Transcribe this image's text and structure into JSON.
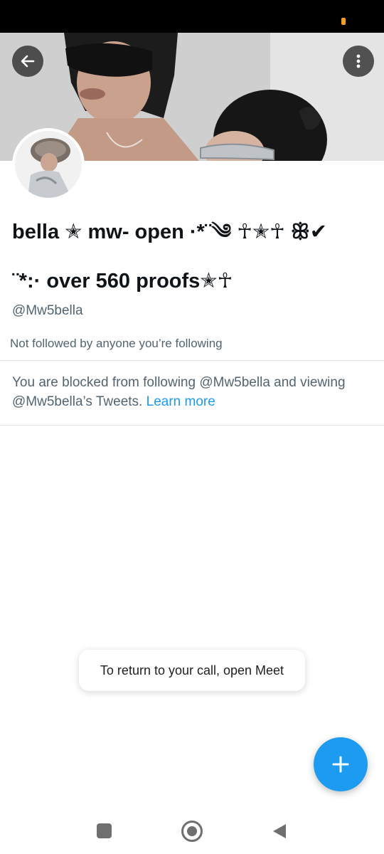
{
  "colors": {
    "accent": "#1d9bf0",
    "text_primary": "#0f1419",
    "text_secondary": "#536471",
    "status_indicator": "#f0a02b"
  },
  "header": {
    "back_icon": "arrow-left-icon",
    "more_icon": "more-vertical-icon"
  },
  "profile": {
    "display_name_line1": "bella ✭ mw- open ·*¨༄ ☥✭☥ ꕥ✔",
    "display_name_line2": "¨*:· over 560 proofs✭☥",
    "handle": "@Mw5bella",
    "followed_by": "Not followed by anyone you’re following"
  },
  "blocked": {
    "message": "You are blocked from following @Mw5bella and viewing @Mw5bella’s Tweets.",
    "learn_more": "Learn more"
  },
  "toast": {
    "text": "To return to your call, open Meet"
  },
  "fab": {
    "icon": "plus-icon"
  },
  "nav": {
    "recents_icon": "square-icon",
    "home_icon": "circle-home-icon",
    "back_icon": "triangle-back-icon"
  }
}
